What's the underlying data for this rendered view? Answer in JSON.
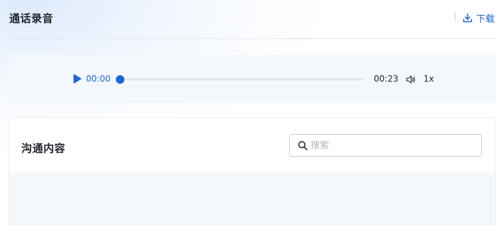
{
  "header": {
    "title": "通话录音",
    "download_label": "下载"
  },
  "player": {
    "current_time": "00:00",
    "total_time": "00:23",
    "speed": "1x",
    "progress": 0
  },
  "content": {
    "title": "沟通内容",
    "search_placeholder": "搜索"
  },
  "colors": {
    "accent": "#1a66d6",
    "panel_bg": "#f4f8fd"
  },
  "icons": {
    "download": "download-icon",
    "play": "play-icon",
    "volume": "volume-icon",
    "search": "search-icon"
  }
}
